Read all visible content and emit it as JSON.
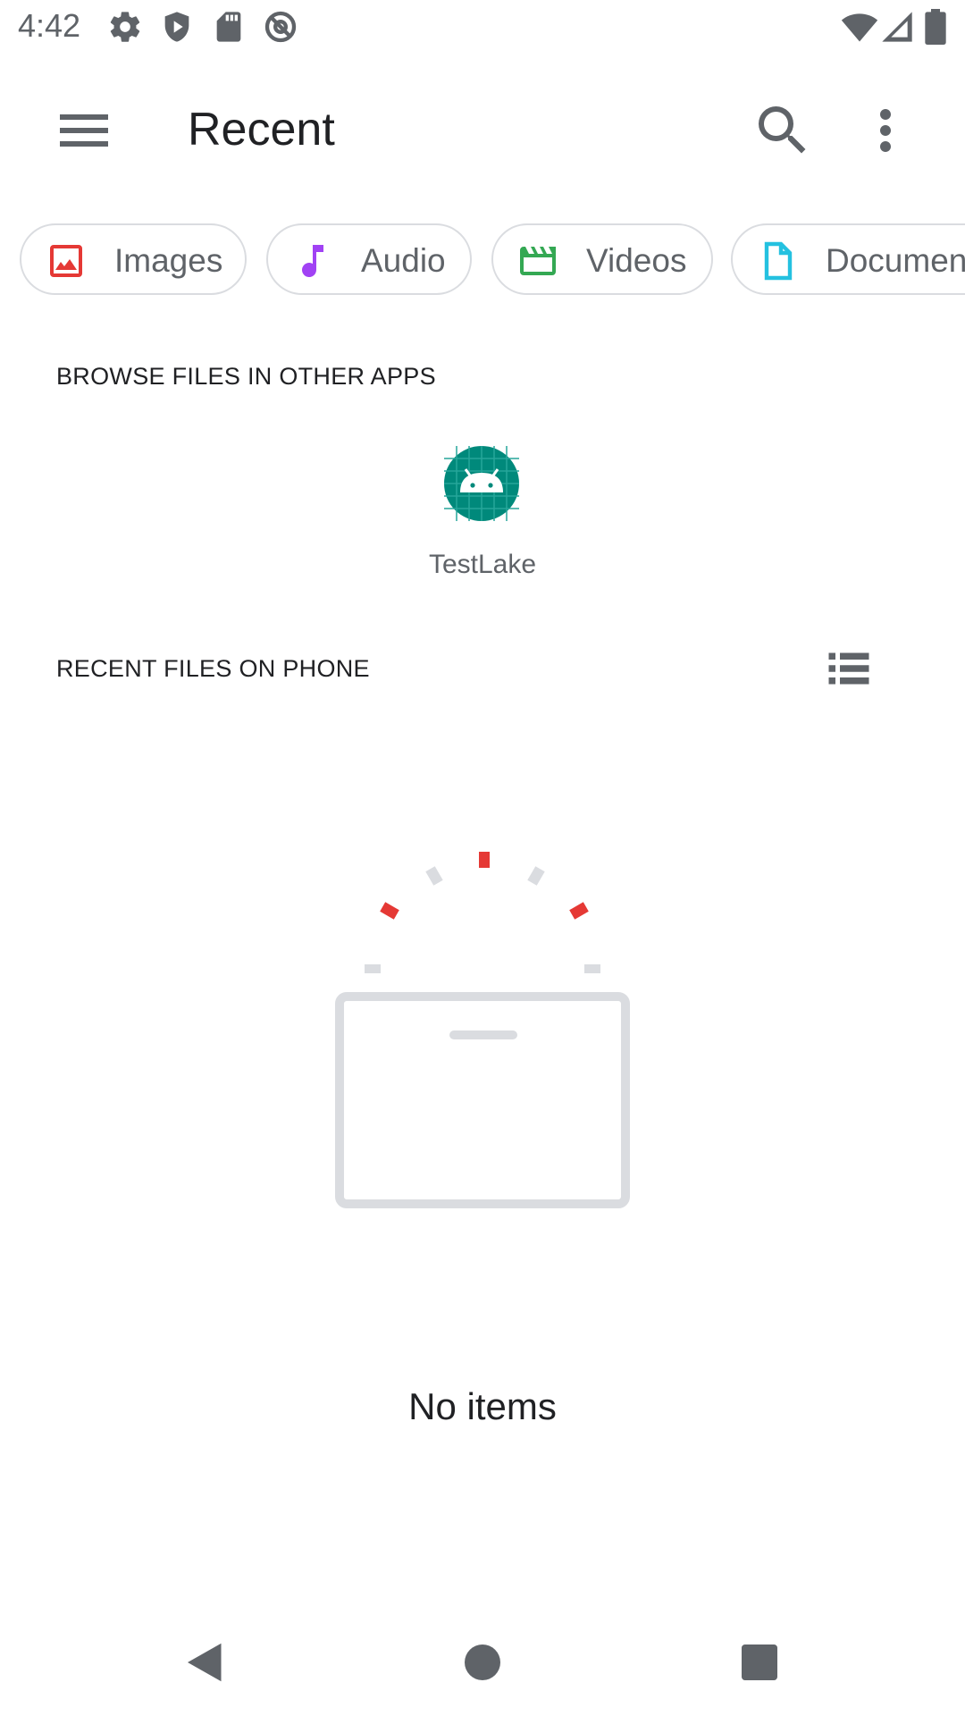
{
  "status_bar": {
    "time": "4:42",
    "left_icons": [
      "gear-icon",
      "shield-icon",
      "sd-card-icon",
      "at-sign-icon"
    ],
    "right_icons": [
      "wifi-icon",
      "cellular-signal-icon",
      "battery-icon"
    ]
  },
  "app_bar": {
    "title": "Recent",
    "icons": [
      "menu-icon",
      "search-icon",
      "more-vert-icon"
    ]
  },
  "chips": [
    {
      "label": "Images",
      "icon": "image-icon",
      "color": "#e53935"
    },
    {
      "label": "Audio",
      "icon": "music-note-icon",
      "color": "#a142f4"
    },
    {
      "label": "Videos",
      "icon": "video-clapper-icon",
      "color": "#34a853"
    },
    {
      "label": "Documents",
      "icon": "document-icon",
      "color": "#24c1e0"
    }
  ],
  "browse_section": {
    "header": "BROWSE FILES IN OTHER APPS",
    "apps": [
      {
        "label": "TestLake",
        "icon": "android-app-icon",
        "color": "#00897b"
      }
    ]
  },
  "recent_section": {
    "header": "RECENT FILES ON PHONE",
    "view_toggle_icon": "list-view-icon"
  },
  "empty_state": {
    "message": "No items",
    "illustration": "empty-tray-illustration",
    "accent_color": "#e53935"
  },
  "nav_bar": {
    "icons": [
      "back-icon",
      "home-icon",
      "recents-icon"
    ]
  }
}
